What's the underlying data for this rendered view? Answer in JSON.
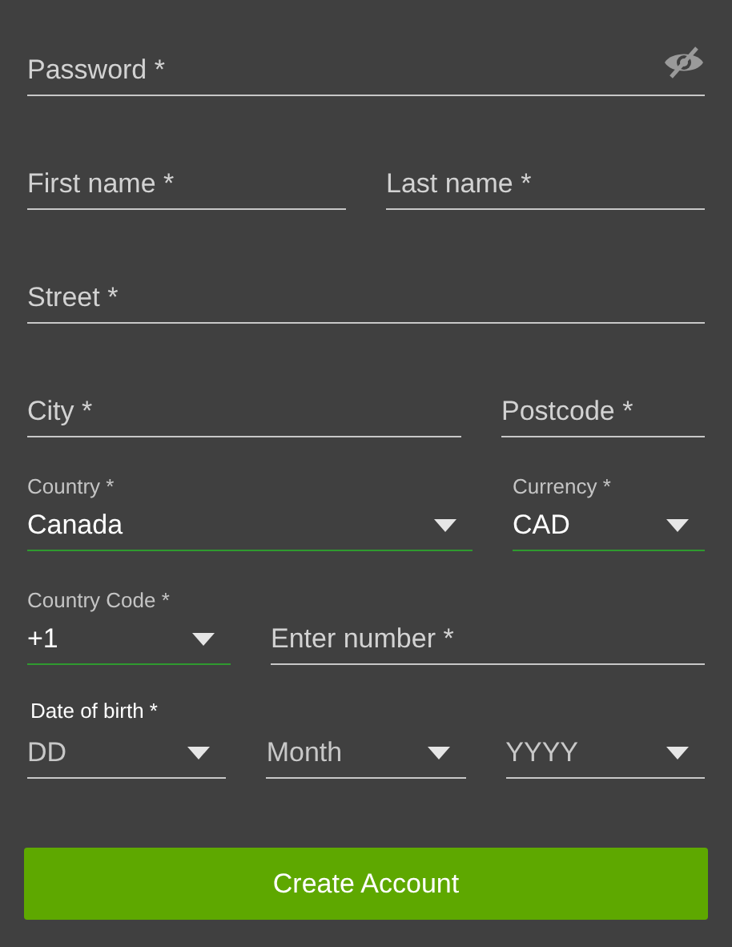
{
  "rows": [
    {
      "fields": [
        {
          "kind": "text",
          "placeholder": "Password *",
          "reveal_toggle": true
        }
      ]
    },
    {
      "fields": [
        {
          "kind": "text",
          "placeholder": "First name *"
        },
        {
          "kind": "text",
          "placeholder": "Last name *"
        }
      ]
    },
    {
      "fields": [
        {
          "kind": "text",
          "placeholder": "Street *"
        }
      ]
    },
    {
      "fields": [
        {
          "kind": "text",
          "placeholder": "City *"
        },
        {
          "kind": "text",
          "placeholder": "Postcode *"
        }
      ]
    },
    {
      "fields": [
        {
          "kind": "select",
          "label": "Country *",
          "value": "Canada",
          "valid": true
        },
        {
          "kind": "select",
          "label": "Currency *",
          "value": "CAD",
          "valid": true
        }
      ]
    },
    {
      "fields": [
        {
          "kind": "select",
          "label": "Country Code *",
          "value": "+1",
          "valid": true
        },
        {
          "kind": "text",
          "placeholder": "Enter number *"
        }
      ]
    },
    {
      "label": "Date of birth *",
      "fields": [
        {
          "kind": "select",
          "placeholder": "DD",
          "valid": false
        },
        {
          "kind": "select",
          "placeholder": "Month",
          "valid": false
        },
        {
          "kind": "select",
          "placeholder": "YYYY",
          "valid": false
        }
      ]
    }
  ],
  "button": "Create Account"
}
